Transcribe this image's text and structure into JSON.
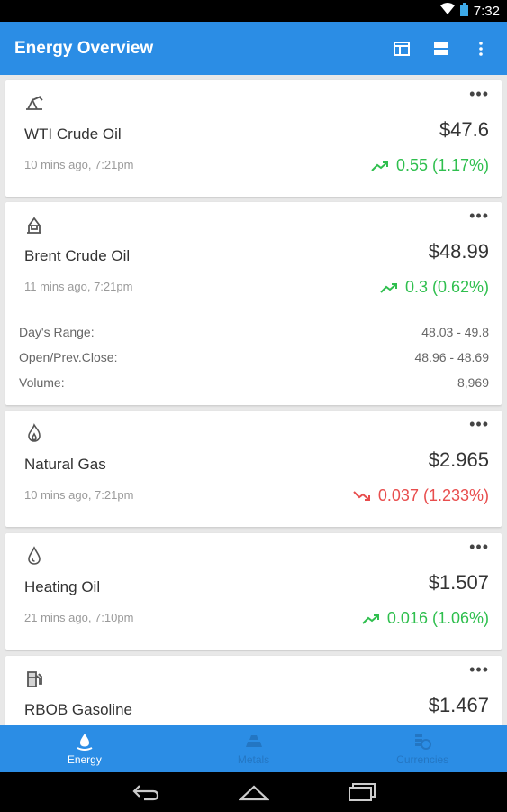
{
  "status_bar": {
    "time": "7:32"
  },
  "app_bar": {
    "title": "Energy Overview"
  },
  "cards": [
    {
      "name": "WTI Crude Oil",
      "price": "$47.6",
      "time": "10 mins ago, 7:21pm",
      "change": "0.55 (1.17%)",
      "direction": "up",
      "icon": "oil-pump-icon"
    },
    {
      "name": "Brent Crude Oil",
      "price": "$48.99",
      "time": "11 mins ago, 7:21pm",
      "change": "0.3 (0.62%)",
      "direction": "up",
      "icon": "oil-rig-icon",
      "details": [
        {
          "label": "Day's Range:",
          "value": "48.03 - 49.8"
        },
        {
          "label": "Open/Prev.Close:",
          "value": "48.96 - 48.69"
        },
        {
          "label": "Volume:",
          "value": "8,969"
        }
      ]
    },
    {
      "name": "Natural Gas",
      "price": "$2.965",
      "time": "10 mins ago, 7:21pm",
      "change": "0.037 (1.233%)",
      "direction": "down",
      "icon": "flame-icon"
    },
    {
      "name": "Heating Oil",
      "price": "$1.507",
      "time": "21 mins ago, 7:10pm",
      "change": "0.016 (1.06%)",
      "direction": "up",
      "icon": "oil-drop-icon"
    },
    {
      "name": "RBOB Gasoline",
      "price": "$1.467",
      "icon": "gas-pump-icon"
    }
  ],
  "bottom_nav": [
    {
      "label": "Energy",
      "active": true
    },
    {
      "label": "Metals",
      "active": false
    },
    {
      "label": "Currencies",
      "active": false
    }
  ],
  "colors": {
    "accent": "#2b8de5",
    "up": "#2fbf4e",
    "down": "#e84d4d"
  }
}
